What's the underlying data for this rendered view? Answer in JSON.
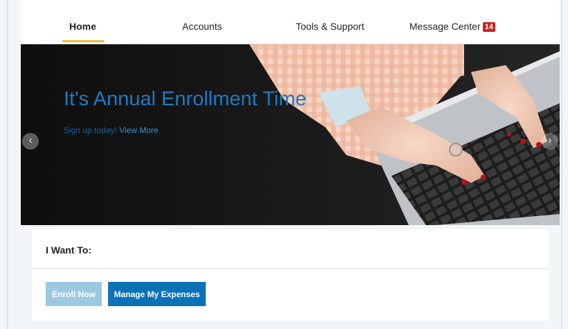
{
  "nav": {
    "items": [
      {
        "label": "Home",
        "active": true
      },
      {
        "label": "Accounts",
        "active": false
      },
      {
        "label": "Tools & Support",
        "active": false
      },
      {
        "label": "Message Center",
        "active": false,
        "badge": "14"
      }
    ]
  },
  "hero": {
    "title": "It's Annual Enrollment Time",
    "subtitle_prefix": "Sign up today!",
    "subtitle_link": "View More",
    "prev_arrow": "‹",
    "next_arrow": "›",
    "image": "person-typing-on-laptop"
  },
  "panel": {
    "title": "I Want To:",
    "buttons": {
      "enroll": "Enroll Now",
      "manage": "Manage My Expenses"
    }
  },
  "colors": {
    "accent_underline": "#f2b632",
    "badge": "#cc1f1f",
    "primary_button": "#0b72b8",
    "disabled_button": "#9dc8e2",
    "hero_title": "#1f7ac1"
  }
}
